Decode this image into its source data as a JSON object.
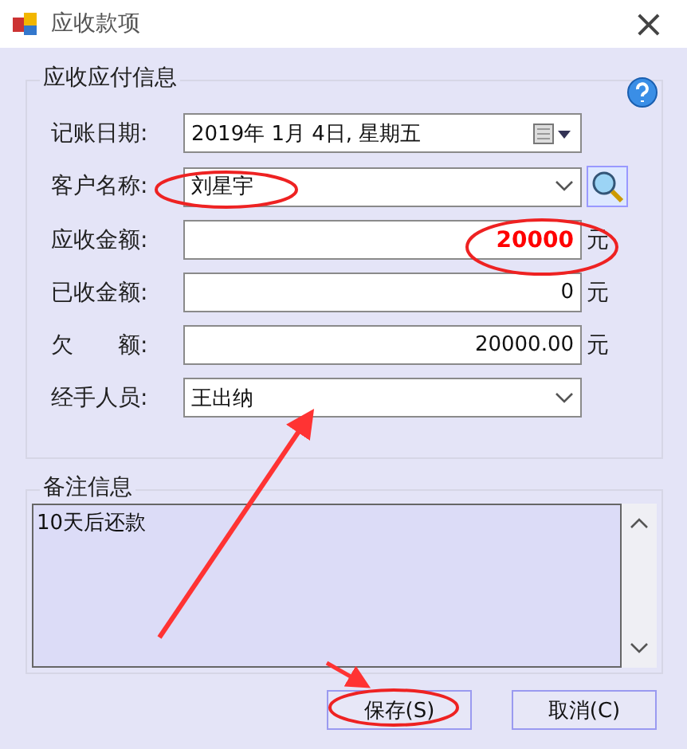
{
  "window": {
    "title": "应收款项",
    "close": "×"
  },
  "info_group": {
    "title": "应收应付信息",
    "fields": [
      {
        "kind": "date",
        "label": "记账日期:",
        "value": "2019年 1月 4日, 星期五"
      },
      {
        "kind": "lookup",
        "label": "客户名称:",
        "value": "刘星宇"
      },
      {
        "kind": "amount",
        "label": "应收金额:",
        "value": "20000",
        "unit": "元",
        "highlight": true
      },
      {
        "kind": "amount",
        "label": "已收金额:",
        "value": "0",
        "unit": "元",
        "highlight": false
      },
      {
        "kind": "amount",
        "label": "欠　　额:",
        "value": "20000.00",
        "unit": "元",
        "highlight": false
      },
      {
        "kind": "combo",
        "label": "经手人员:",
        "value": "王出纳"
      }
    ]
  },
  "notes_group": {
    "title": "备注信息",
    "value": "10天后还款"
  },
  "buttons": [
    "保存(S)",
    "取消(C)"
  ]
}
